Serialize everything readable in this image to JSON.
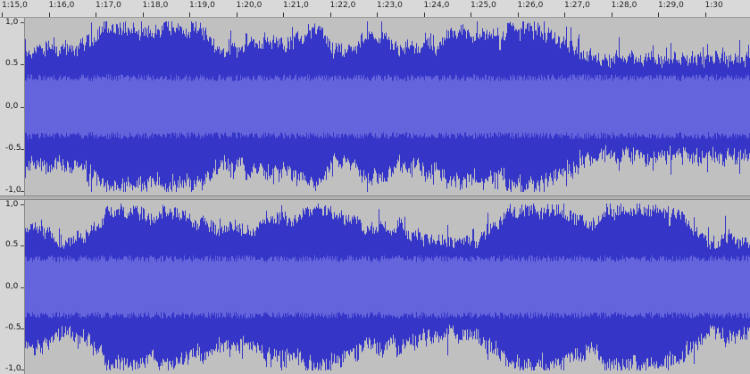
{
  "timeline": {
    "ticks": [
      "1:15,0",
      "1:16,0",
      "1:17,0",
      "1:18,0",
      "1:19,0",
      "1:20,0",
      "1:21,0",
      "1:22,0",
      "1:23,0",
      "1:24,0",
      "1:25,0",
      "1:26,0",
      "1:27,0",
      "1:28,0",
      "1:29,0",
      "1:30"
    ]
  },
  "tracks": [
    {
      "channel": "left",
      "scale_labels": [
        "1,0",
        "0.5",
        "0,0",
        "-0.5",
        "-1,0"
      ],
      "scale_values": [
        1.0,
        0.5,
        0.0,
        -0.5,
        -1.0
      ]
    },
    {
      "channel": "right",
      "scale_labels": [
        "1,0",
        "0.5",
        "0,0",
        "-0.5",
        "-1,0"
      ],
      "scale_values": [
        1.0,
        0.5,
        0.0,
        -0.5,
        -1.0
      ]
    }
  ],
  "colors": {
    "waveform_peak": "#3535c8",
    "waveform_rms": "#6464dc",
    "background": "#c0c0c0"
  }
}
